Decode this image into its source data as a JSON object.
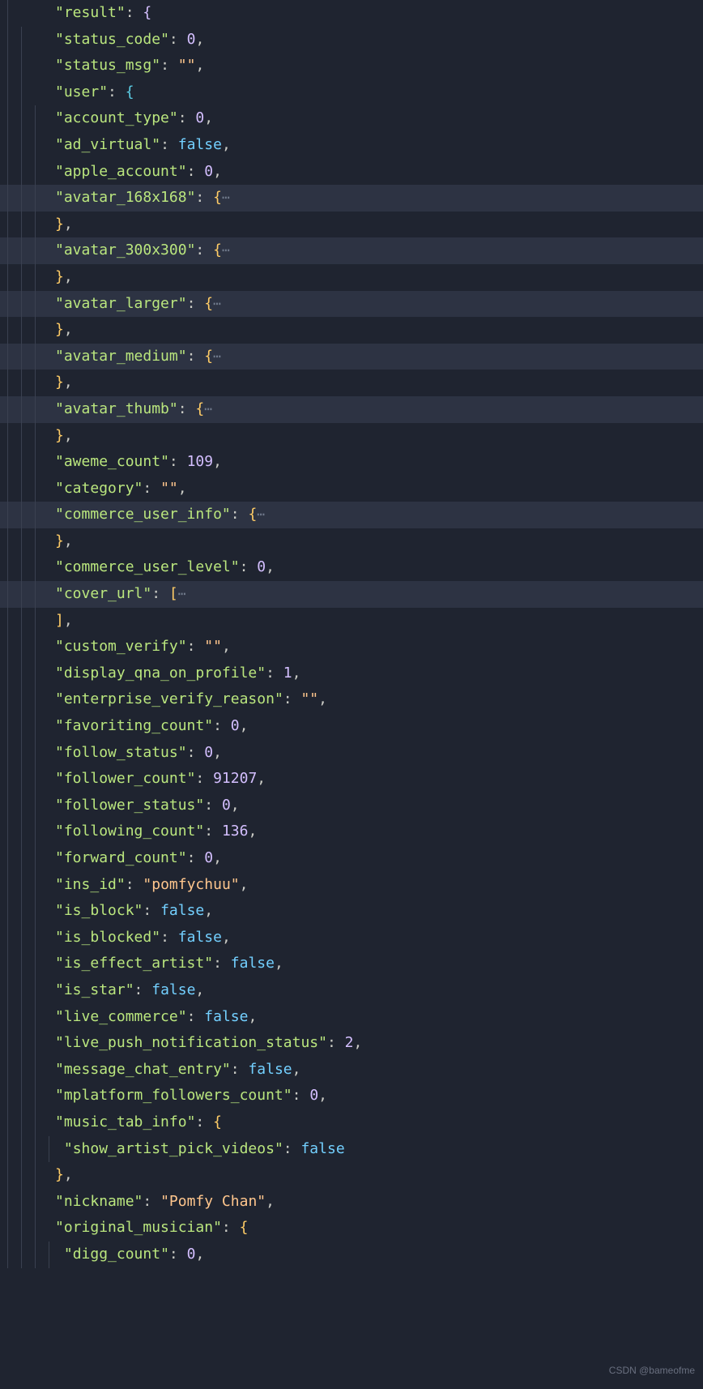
{
  "watermark": "CSDN @bameofme",
  "json": {
    "root_key": "result",
    "status_code_key": "status_code",
    "status_code_val": "0",
    "status_msg_key": "status_msg",
    "status_msg_val": "\"\"",
    "user_key": "user",
    "user": {
      "account_type_key": "account_type",
      "account_type_val": "0",
      "ad_virtual_key": "ad_virtual",
      "ad_virtual_val": "false",
      "apple_account_key": "apple_account",
      "apple_account_val": "0",
      "avatar_168_key": "avatar_168x168",
      "avatar_300_key": "avatar_300x300",
      "avatar_larger_key": "avatar_larger",
      "avatar_medium_key": "avatar_medium",
      "avatar_thumb_key": "avatar_thumb",
      "aweme_count_key": "aweme_count",
      "aweme_count_val": "109",
      "category_key": "category",
      "category_val": "\"\"",
      "commerce_user_info_key": "commerce_user_info",
      "commerce_user_level_key": "commerce_user_level",
      "commerce_user_level_val": "0",
      "cover_url_key": "cover_url",
      "custom_verify_key": "custom_verify",
      "custom_verify_val": "\"\"",
      "display_qna_key": "display_qna_on_profile",
      "display_qna_val": "1",
      "enterprise_verify_key": "enterprise_verify_reason",
      "enterprise_verify_val": "\"\"",
      "favoriting_count_key": "favoriting_count",
      "favoriting_count_val": "0",
      "follow_status_key": "follow_status",
      "follow_status_val": "0",
      "follower_count_key": "follower_count",
      "follower_count_val": "91207",
      "follower_status_key": "follower_status",
      "follower_status_val": "0",
      "following_count_key": "following_count",
      "following_count_val": "136",
      "forward_count_key": "forward_count",
      "forward_count_val": "0",
      "ins_id_key": "ins_id",
      "ins_id_val": "\"pomfychuu\"",
      "is_block_key": "is_block",
      "is_block_val": "false",
      "is_blocked_key": "is_blocked",
      "is_blocked_val": "false",
      "is_effect_artist_key": "is_effect_artist",
      "is_effect_artist_val": "false",
      "is_star_key": "is_star",
      "is_star_val": "false",
      "live_commerce_key": "live_commerce",
      "live_commerce_val": "false",
      "live_push_key": "live_push_notification_status",
      "live_push_val": "2",
      "message_chat_entry_key": "message_chat_entry",
      "message_chat_entry_val": "false",
      "mplatform_followers_key": "mplatform_followers_count",
      "mplatform_followers_val": "0",
      "music_tab_info_key": "music_tab_info",
      "show_artist_pick_key": "show_artist_pick_videos",
      "show_artist_pick_val": "false",
      "nickname_key": "nickname",
      "nickname_val": "\"Pomfy Chan\"",
      "original_musician_key": "original_musician",
      "digg_count_key": "digg_count",
      "digg_count_val": "0"
    }
  }
}
